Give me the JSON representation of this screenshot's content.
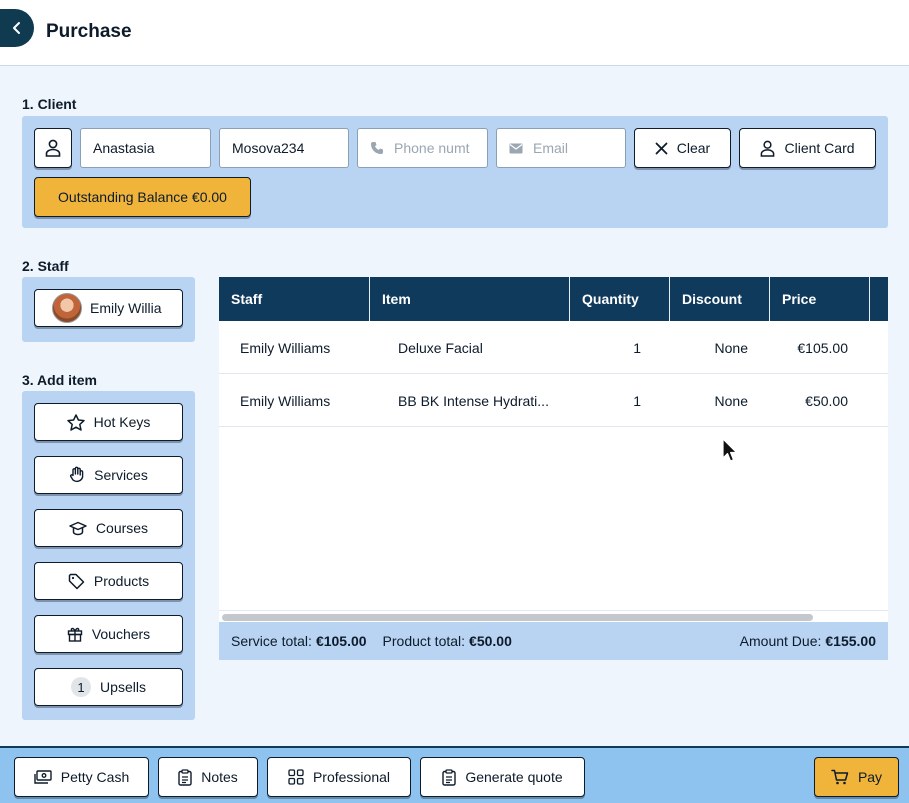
{
  "header": {
    "title": "Purchase"
  },
  "client": {
    "section_label": "1. Client",
    "first_name": "Anastasia",
    "last_name": "Mosova234",
    "phone_placeholder": "Phone numt",
    "email_placeholder": "Email",
    "clear_label": "Clear",
    "client_card_label": "Client Card",
    "balance_label": "Outstanding Balance €0.00"
  },
  "staff": {
    "section_label": "2. Staff",
    "selected_name": "Emily Willia"
  },
  "add_item": {
    "section_label": "3. Add item",
    "buttons": [
      {
        "label": "Hot Keys",
        "icon": "star-icon"
      },
      {
        "label": "Services",
        "icon": "hand-icon"
      },
      {
        "label": "Courses",
        "icon": "graduation-cap-icon"
      },
      {
        "label": "Products",
        "icon": "tag-icon"
      },
      {
        "label": "Vouchers",
        "icon": "gift-icon"
      },
      {
        "label": "Upsells",
        "icon": "count-badge",
        "badge": "1"
      }
    ]
  },
  "table": {
    "columns": [
      "Staff",
      "Item",
      "Quantity",
      "Discount",
      "Price"
    ],
    "rows": [
      {
        "staff": "Emily Williams",
        "item": "Deluxe Facial",
        "quantity": "1",
        "discount": "None",
        "price": "€105.00"
      },
      {
        "staff": "Emily Williams",
        "item": "BB BK Intense Hydrati...",
        "quantity": "1",
        "discount": "None",
        "price": "€50.00"
      }
    ],
    "totals": {
      "service_label": "Service total:",
      "service_value": "€105.00",
      "product_label": "Product total:",
      "product_value": "€50.00",
      "amount_due_label": "Amount Due:",
      "amount_due_value": "€155.00"
    }
  },
  "footer": {
    "petty_cash": "Petty Cash",
    "notes": "Notes",
    "professional": "Professional",
    "generate_quote": "Generate quote",
    "pay": "Pay"
  },
  "colors": {
    "header_dark": "#0f3a5c",
    "panel_blue": "#b9d4f3",
    "accent_yellow": "#f0b43a",
    "footer_blue": "#8fc3ef"
  }
}
